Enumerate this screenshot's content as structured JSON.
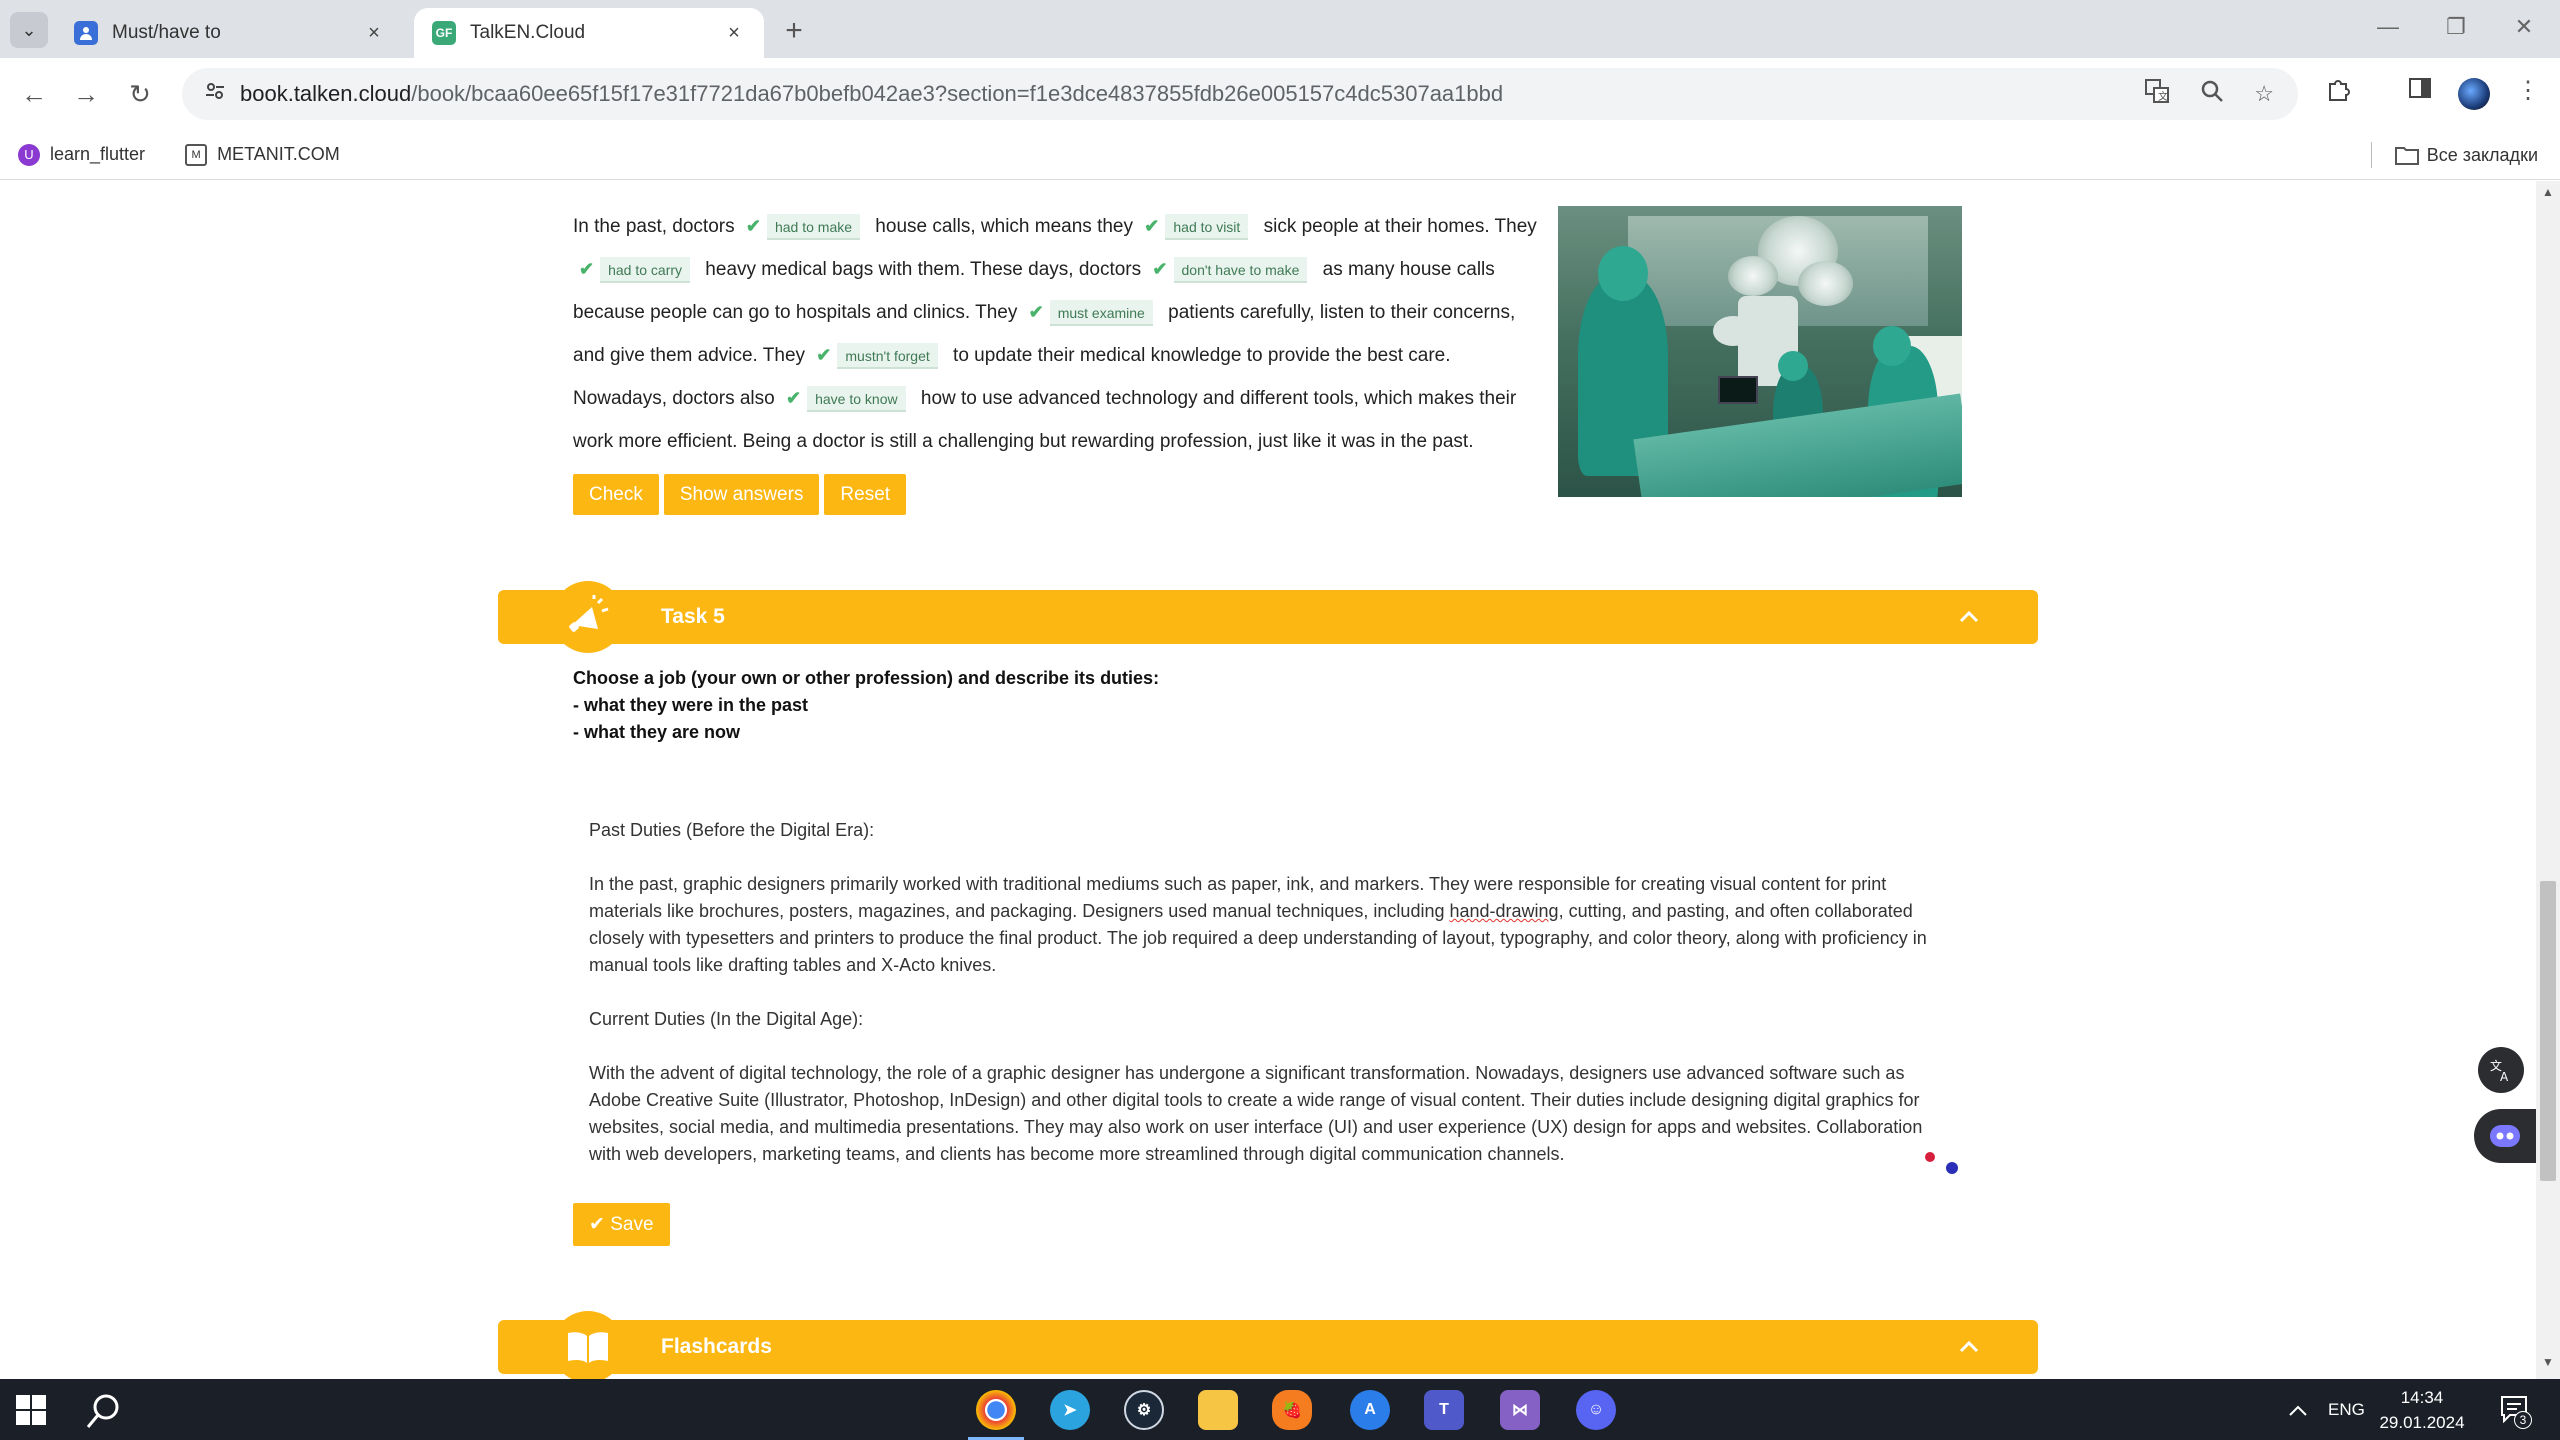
{
  "browser": {
    "tabs": [
      {
        "title": "Must/have to",
        "active": false,
        "favicon": "person-icon"
      },
      {
        "title": "TalkEN.Cloud",
        "active": true,
        "favicon": "GF"
      }
    ],
    "url_host": "book.talken.cloud",
    "url_path": "/book/bcaa60ee65f15f17e31f7721da67b0befb042ae3?section=f1e3dce4837855fdb26e005157c4dc5307aa1bbd",
    "bookmarks": [
      {
        "label": "learn_flutter",
        "icon": "flutter-icon"
      },
      {
        "label": "METANIT.COM",
        "icon": "metanit-icon"
      }
    ],
    "bookmarks_folder": "Все закладки"
  },
  "exercise": {
    "segments": [
      {
        "text": "In the past, doctors "
      },
      {
        "answer": "had to make"
      },
      {
        "text": " house calls, which means they "
      },
      {
        "answer": "had to visit"
      },
      {
        "text": " sick people at their homes. They "
      },
      {
        "answer": "had to carry"
      },
      {
        "text": " heavy medical bags with them. These days, doctors "
      },
      {
        "answer": "don't have to make"
      },
      {
        "text": " as many house calls because people can go to hospitals and clinics. They "
      },
      {
        "answer": "must examine"
      },
      {
        "text": " patients carefully, listen to their concerns, and give them advice. They "
      },
      {
        "answer": "mustn't forget"
      },
      {
        "text": " to update their medical knowledge to provide the best care. Nowadays, doctors also "
      },
      {
        "answer": "have to know"
      },
      {
        "text": " how to use advanced technology and different tools, which makes their work more efficient. Being a doctor is still a challenging but rewarding profession, just like it was in the past."
      }
    ],
    "buttons": {
      "check": "Check",
      "show_answers": "Show answers",
      "reset": "Reset"
    }
  },
  "task5": {
    "title": "Task 5",
    "instructions": [
      "Choose a job (your own or other profession) and describe its duties:",
      "- what they were in the past",
      "- what they are now"
    ],
    "answer": {
      "heading_past": "Past Duties (Before the Digital Era):",
      "past_before": "In the past, graphic designers primarily worked with traditional mediums such as paper, ink, and markers. They were responsible for creating visual content for print materials like brochures, posters, magazines, and packaging. Designers used manual techniques, including ",
      "past_misspelled": "hand-drawing",
      "past_after": ", cutting, and pasting, and often collaborated closely with typesetters and printers to produce the final product. The job required a deep understanding of layout, typography, and color theory, along with proficiency in manual tools like drafting tables and X-Acto knives.",
      "heading_current": "Current Duties (In the Digital Age):",
      "current": "With the advent of digital technology, the role of a graphic designer has undergone a significant transformation. Nowadays, designers use advanced software such as Adobe Creative Suite (Illustrator, Photoshop, InDesign) and other digital tools to create a wide range of visual content. Their duties include designing digital graphics for websites, social media, and multimedia presentations. They may also work on user interface (UI) and user experience (UX) design for apps and websites. Collaboration with web developers, marketing teams, and clients has become more streamlined through digital communication channels."
    },
    "save_label": "Save"
  },
  "flashcards": {
    "title": "Flashcards"
  },
  "taskbar": {
    "apps": [
      "chrome",
      "telegram",
      "steam",
      "file-explorer",
      "fl-studio",
      "app-store",
      "teams",
      "visual-studio",
      "discord"
    ],
    "language": "ENG",
    "time": "14:34",
    "date": "29.01.2024",
    "notifications": "3"
  },
  "colors": {
    "accent": "#fdb713",
    "correct": "#49b36b"
  }
}
